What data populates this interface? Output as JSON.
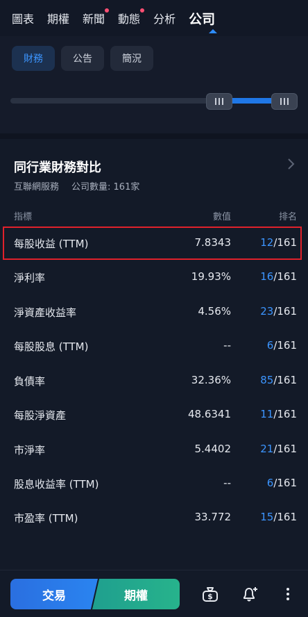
{
  "top_tabs": [
    {
      "label": "圖表",
      "dot": false
    },
    {
      "label": "期權",
      "dot": false
    },
    {
      "label": "新聞",
      "dot": true
    },
    {
      "label": "動態",
      "dot": true
    },
    {
      "label": "分析",
      "dot": false
    },
    {
      "label": "公司",
      "dot": false,
      "active": true
    }
  ],
  "sub_tabs": [
    {
      "label": "財務",
      "active": true
    },
    {
      "label": "公告",
      "active": false
    },
    {
      "label": "簡況",
      "active": false
    }
  ],
  "card": {
    "title": "同行業財務對比",
    "industry": "互聯網服務",
    "company_count": "公司數量: 161家",
    "headers": {
      "indicator": "指標",
      "value": "數值",
      "rank": "排名"
    }
  },
  "rows": [
    {
      "name": "每股收益 (TTM)",
      "value": "7.8343",
      "rank": "12",
      "total": "/161",
      "highlighted": true
    },
    {
      "name": "淨利率",
      "value": "19.93%",
      "rank": "16",
      "total": "/161"
    },
    {
      "name": "淨資產收益率",
      "value": "4.56%",
      "rank": "23",
      "total": "/161"
    },
    {
      "name": "每股股息 (TTM)",
      "value": "--",
      "rank": "6",
      "total": "/161"
    },
    {
      "name": "負債率",
      "value": "32.36%",
      "rank": "85",
      "total": "/161"
    },
    {
      "name": "每股淨資產",
      "value": "48.6341",
      "rank": "11",
      "total": "/161"
    },
    {
      "name": "市淨率",
      "value": "5.4402",
      "rank": "21",
      "total": "/161"
    },
    {
      "name": "股息收益率 (TTM)",
      "value": "--",
      "rank": "6",
      "total": "/161"
    },
    {
      "name": "市盈率 (TTM)",
      "value": "33.772",
      "rank": "15",
      "total": "/161"
    }
  ],
  "bottom": {
    "trade_label": "交易",
    "options_label": "期權",
    "icons": [
      "money-bag-icon",
      "bell-plus-icon",
      "more-vertical-icon"
    ]
  },
  "colors": {
    "accent": "#3c95ff",
    "notify_dot": "#ff4f73",
    "highlight_box": "#e0212b",
    "trade_button": "#2a7aea",
    "options_button": "#23a98d"
  }
}
